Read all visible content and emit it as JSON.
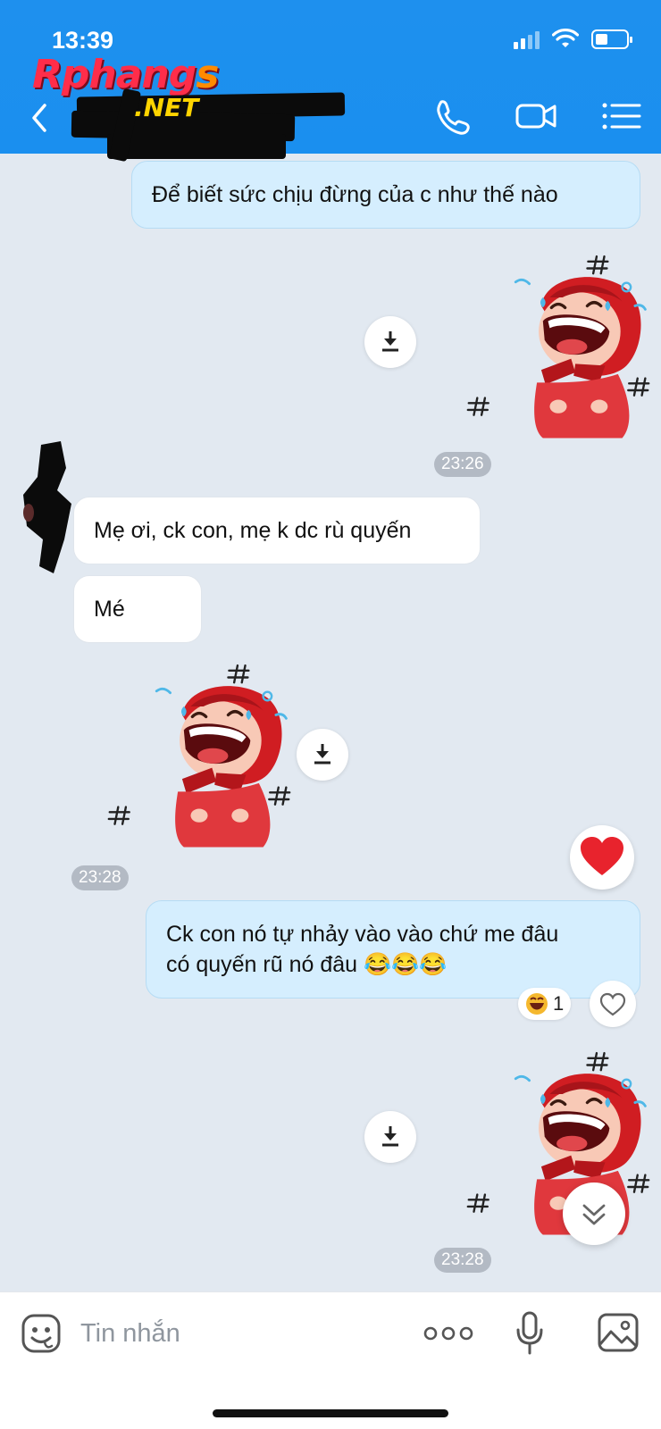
{
  "status_bar": {
    "time": "13:39"
  },
  "watermark": {
    "main": "Rphang",
    "accent": "s",
    "suffix": ".NET"
  },
  "header": {
    "back_icon": "chevron-left-icon",
    "contact_name": "",
    "actions": [
      "phone-icon",
      "video-icon",
      "menu-icon"
    ]
  },
  "messages": [
    {
      "type": "text",
      "direction": "out",
      "lines": [
        "Để biết sức chịu đừng của c như thế nào"
      ]
    },
    {
      "type": "sticker",
      "direction": "out",
      "time": "23:26"
    },
    {
      "type": "text",
      "direction": "in",
      "lines": [
        "Mẹ ơi, ck con, mẹ k dc rù quyến"
      ]
    },
    {
      "type": "text",
      "direction": "in",
      "lines": [
        "Mé"
      ]
    },
    {
      "type": "sticker",
      "direction": "in",
      "time": "23:28"
    },
    {
      "type": "text",
      "direction": "out",
      "lines": [
        "Ck con nó tự nhảy vào vào chứ me đâu",
        "có quyến rũ nó đâu 😂😂😂"
      ],
      "reaction_count": "1"
    },
    {
      "type": "sticker",
      "direction": "out",
      "time": "23:28"
    }
  ],
  "composer": {
    "placeholder": "Tin nhắn",
    "icons": [
      "sticker-icon",
      "more-icon",
      "microphone-icon",
      "image-icon"
    ]
  },
  "colors": {
    "header": "#1a8fef",
    "outgoing_bubble": "#d5eefe",
    "incoming_bubble": "#ffffff",
    "background": "#e2e9f1"
  }
}
